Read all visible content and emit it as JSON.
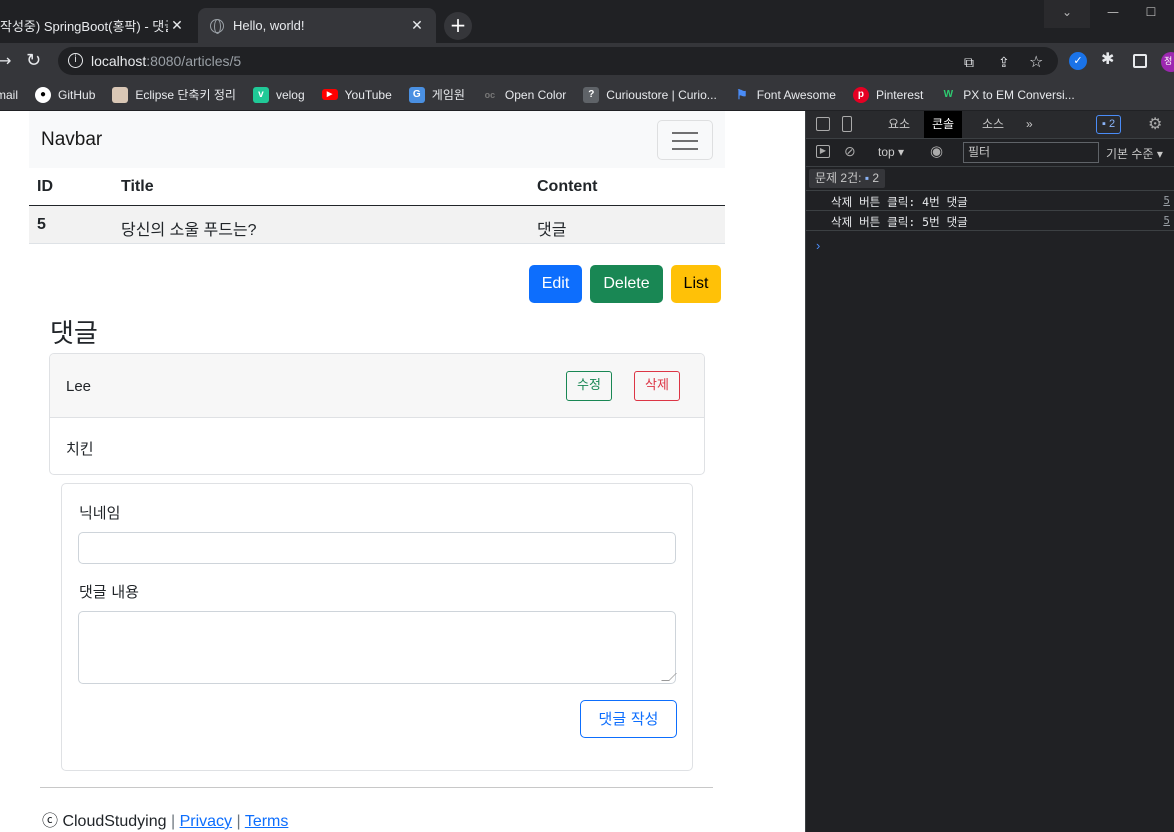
{
  "browser": {
    "tabs": [
      {
        "title": "작성중) SpringBoot(홍팍) - 댓글",
        "active": false
      },
      {
        "title": "Hello, world!",
        "active": true
      }
    ],
    "url_host": "localhost",
    "url_path": ":8080/articles/5",
    "bookmarks": [
      "mail",
      "GitHub",
      "Eclipse 단축키 정리",
      "velog",
      "YouTube",
      "게임원",
      "Open Color",
      "Curioustore | Curio...",
      "Font Awesome",
      "Pinterest",
      "PX to EM Conversi..."
    ],
    "profile_initial": "정"
  },
  "page": {
    "navbar_brand": "Navbar",
    "table": {
      "headers": [
        "ID",
        "Title",
        "Content"
      ],
      "row": [
        "5",
        "당신의 소울 푸드는?",
        "댓글"
      ]
    },
    "buttons": {
      "edit": "Edit",
      "delete": "Delete",
      "list": "List"
    },
    "comments_heading": "댓글",
    "comment": {
      "nickname": "Lee",
      "body": "치킨",
      "edit_label": "수정",
      "delete_label": "삭제"
    },
    "form": {
      "nickname_label": "닉네임",
      "body_label": "댓글 내용",
      "submit_label": "댓글 작성"
    },
    "footer": {
      "copyright": "ⓒ CloudStudying",
      "privacy": "Privacy",
      "terms": "Terms",
      "sep": "|"
    }
  },
  "devtools": {
    "tabs": [
      "요소",
      "콘솔",
      "소스"
    ],
    "more": "»",
    "issue_badge": "2",
    "context": "top ▾",
    "filter_placeholder": "필터",
    "level": "기본 수준 ▾",
    "issues_label": "문제 2건:",
    "issues_count": "2",
    "logs": [
      {
        "msg": "삭제 버튼 클릭: 4번 댓글",
        "src": "5"
      },
      {
        "msg": "삭제 버튼 클릭: 5번 댓글",
        "src": "5"
      }
    ],
    "prompt": "›"
  }
}
